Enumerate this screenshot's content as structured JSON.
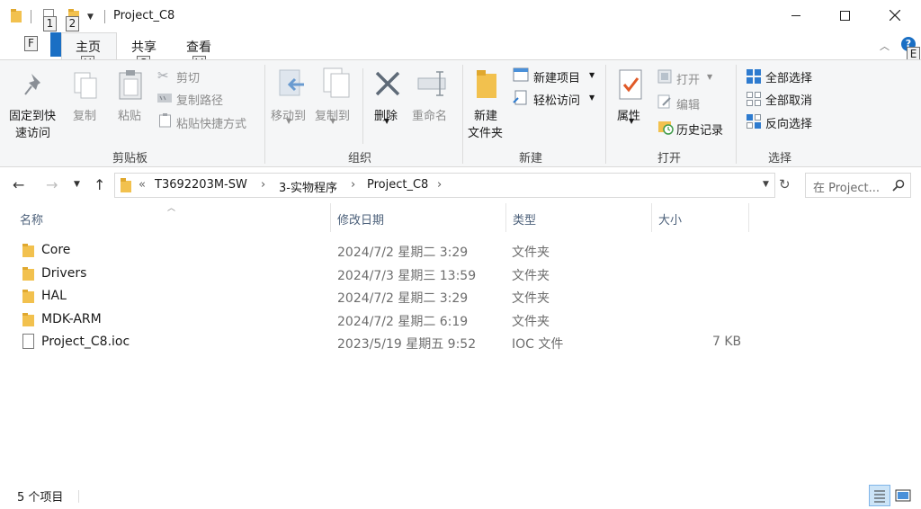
{
  "window": {
    "title": "Project_C8"
  },
  "quick_access": {
    "keytips": [
      "1",
      "2"
    ]
  },
  "ribbon_tabs": [
    {
      "label": "主页",
      "keytip": "H"
    },
    {
      "label": "共享",
      "keytip": "S"
    },
    {
      "label": "查看",
      "keytip": "V"
    }
  ],
  "file_tab_keytip": "F",
  "help_keytip": "E",
  "ribbon": {
    "clipboard": {
      "label": "剪贴板",
      "pin_label_1": "固定到快",
      "pin_label_2": "速访问",
      "copy": "复制",
      "paste": "粘贴",
      "cut": "剪切",
      "copy_path": "复制路径",
      "paste_shortcut": "粘贴快捷方式"
    },
    "organize": {
      "label": "组织",
      "move_to": "移动到",
      "copy_to": "复制到",
      "delete": "删除",
      "rename": "重命名"
    },
    "new": {
      "label": "新建",
      "new_folder_1": "新建",
      "new_folder_2": "文件夹",
      "new_item": "新建项目",
      "easy_access": "轻松访问"
    },
    "open": {
      "label": "打开",
      "properties": "属性",
      "open": "打开",
      "edit": "编辑",
      "history": "历史记录"
    },
    "select": {
      "label": "选择",
      "select_all": "全部选择",
      "select_none": "全部取消",
      "invert": "反向选择"
    }
  },
  "address": {
    "overflow": "«",
    "crumbs": [
      "T3692203M-SW",
      "3-实物程序",
      "Project_C8"
    ]
  },
  "search": {
    "placeholder": "在 Project..."
  },
  "columns": {
    "name": "名称",
    "modified": "修改日期",
    "type": "类型",
    "size": "大小"
  },
  "files": [
    {
      "name": "Core",
      "modified": "2024/7/2 星期二 3:29",
      "type": "文件夹",
      "size": "",
      "kind": "folder"
    },
    {
      "name": "Drivers",
      "modified": "2024/7/3 星期三 13:59",
      "type": "文件夹",
      "size": "",
      "kind": "folder"
    },
    {
      "name": "HAL",
      "modified": "2024/7/2 星期二 3:29",
      "type": "文件夹",
      "size": "",
      "kind": "folder"
    },
    {
      "name": "MDK-ARM",
      "modified": "2024/7/2 星期二 6:19",
      "type": "文件夹",
      "size": "",
      "kind": "folder"
    },
    {
      "name": "Project_C8.ioc",
      "modified": "2023/5/19 星期五 9:52",
      "type": "IOC 文件",
      "size": "7 KB",
      "kind": "file"
    }
  ],
  "status": {
    "item_count": "5 个项目"
  },
  "colors": {
    "accent": "#1a6fc4",
    "folder": "#f2c14e",
    "header_text": "#4c607a"
  }
}
